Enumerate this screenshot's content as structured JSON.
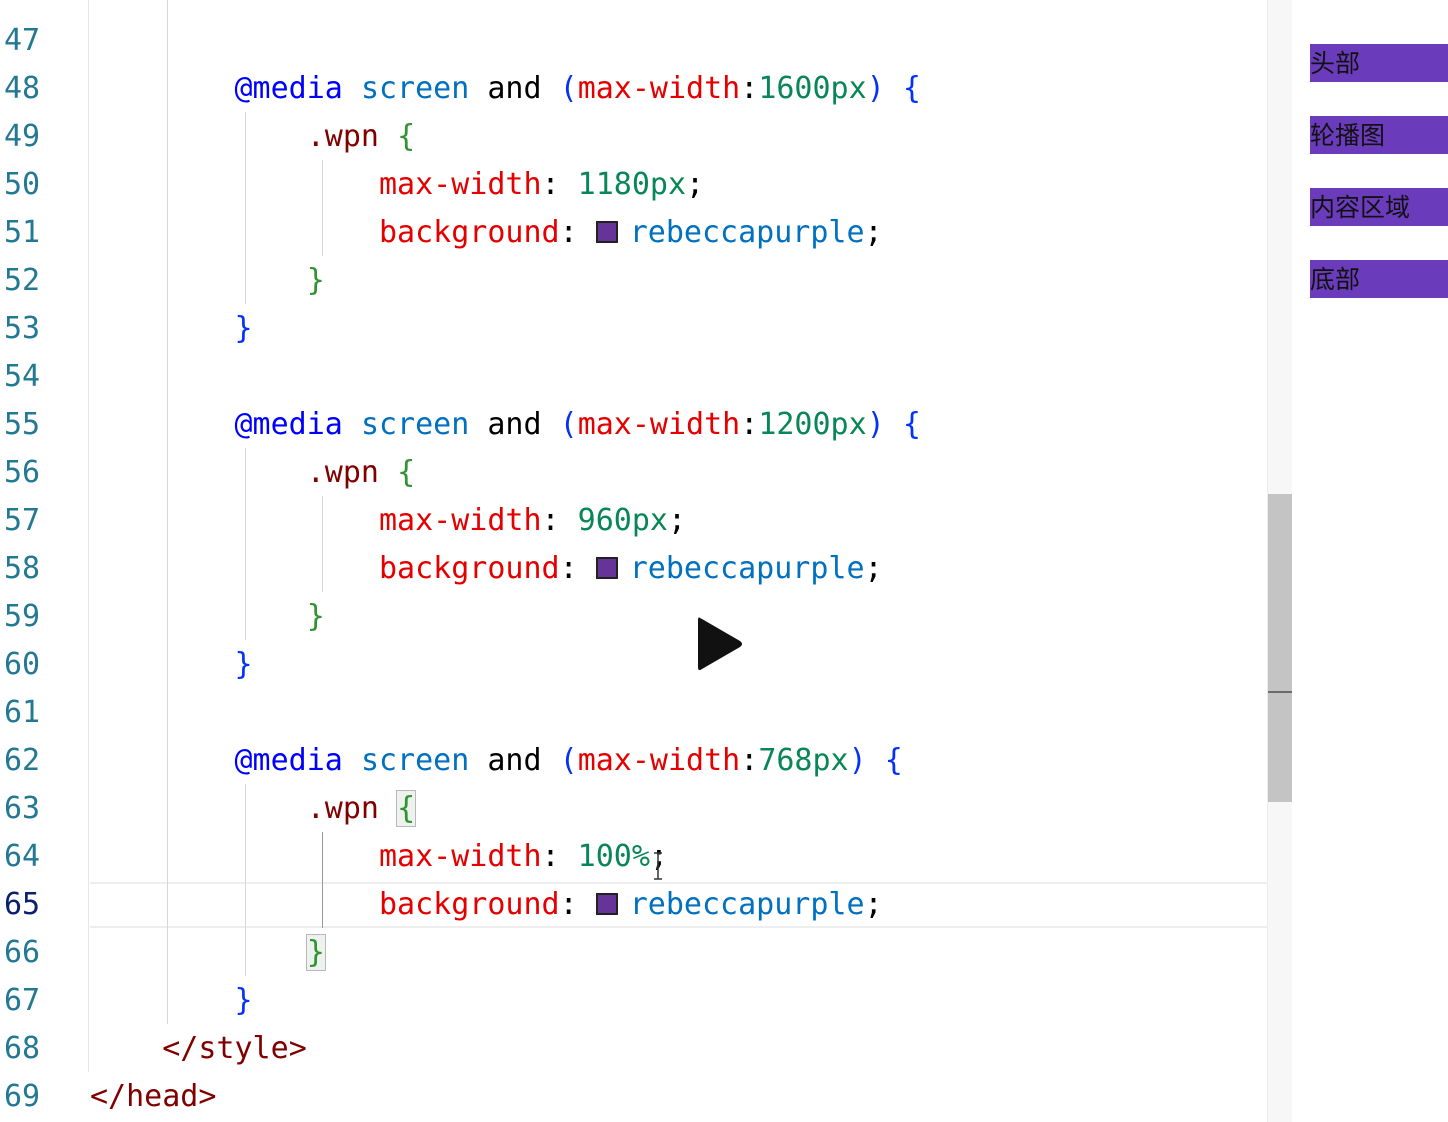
{
  "editor": {
    "lines": [
      {
        "num": "47",
        "tokens": []
      },
      {
        "num": "48",
        "tokens": [
          {
            "t": "        ",
            "c": ""
          },
          {
            "t": "@media",
            "c": "t-at"
          },
          {
            "t": " ",
            "c": ""
          },
          {
            "t": "screen",
            "c": "t-kw"
          },
          {
            "t": " and ",
            "c": ""
          },
          {
            "t": "(",
            "c": "t-paren"
          },
          {
            "t": "max-width",
            "c": "t-prop"
          },
          {
            "t": ":",
            "c": ""
          },
          {
            "t": "1600px",
            "c": "t-num"
          },
          {
            "t": ")",
            "c": "t-paren"
          },
          {
            "t": " ",
            "c": ""
          },
          {
            "t": "{",
            "c": "t-paren"
          }
        ]
      },
      {
        "num": "49",
        "tokens": [
          {
            "t": "            ",
            "c": ""
          },
          {
            "t": ".wpn",
            "c": "t-cls"
          },
          {
            "t": " ",
            "c": ""
          },
          {
            "t": "{",
            "c": "t-brace"
          }
        ]
      },
      {
        "num": "50",
        "tokens": [
          {
            "t": "                ",
            "c": ""
          },
          {
            "t": "max-width",
            "c": "t-prop"
          },
          {
            "t": ": ",
            "c": ""
          },
          {
            "t": "1180px",
            "c": "t-num"
          },
          {
            "t": ";",
            "c": ""
          }
        ]
      },
      {
        "num": "51",
        "tokens": [
          {
            "t": "                ",
            "c": ""
          },
          {
            "t": "background",
            "c": "t-prop"
          },
          {
            "t": ": ",
            "c": ""
          },
          {
            "t": "",
            "c": "swatch"
          },
          {
            "t": "rebeccapurple",
            "c": "t-kw"
          },
          {
            "t": ";",
            "c": ""
          }
        ]
      },
      {
        "num": "52",
        "tokens": [
          {
            "t": "            ",
            "c": ""
          },
          {
            "t": "}",
            "c": "t-brace"
          }
        ]
      },
      {
        "num": "53",
        "tokens": [
          {
            "t": "        ",
            "c": ""
          },
          {
            "t": "}",
            "c": "t-paren"
          }
        ]
      },
      {
        "num": "54",
        "tokens": []
      },
      {
        "num": "55",
        "tokens": [
          {
            "t": "        ",
            "c": ""
          },
          {
            "t": "@media",
            "c": "t-at"
          },
          {
            "t": " ",
            "c": ""
          },
          {
            "t": "screen",
            "c": "t-kw"
          },
          {
            "t": " and ",
            "c": ""
          },
          {
            "t": "(",
            "c": "t-paren"
          },
          {
            "t": "max-width",
            "c": "t-prop"
          },
          {
            "t": ":",
            "c": ""
          },
          {
            "t": "1200px",
            "c": "t-num"
          },
          {
            "t": ")",
            "c": "t-paren"
          },
          {
            "t": " ",
            "c": ""
          },
          {
            "t": "{",
            "c": "t-paren"
          }
        ]
      },
      {
        "num": "56",
        "tokens": [
          {
            "t": "            ",
            "c": ""
          },
          {
            "t": ".wpn",
            "c": "t-cls"
          },
          {
            "t": " ",
            "c": ""
          },
          {
            "t": "{",
            "c": "t-brace"
          }
        ]
      },
      {
        "num": "57",
        "tokens": [
          {
            "t": "                ",
            "c": ""
          },
          {
            "t": "max-width",
            "c": "t-prop"
          },
          {
            "t": ": ",
            "c": ""
          },
          {
            "t": "960px",
            "c": "t-num"
          },
          {
            "t": ";",
            "c": ""
          }
        ]
      },
      {
        "num": "58",
        "tokens": [
          {
            "t": "                ",
            "c": ""
          },
          {
            "t": "background",
            "c": "t-prop"
          },
          {
            "t": ": ",
            "c": ""
          },
          {
            "t": "",
            "c": "swatch"
          },
          {
            "t": "rebeccapurple",
            "c": "t-kw"
          },
          {
            "t": ";",
            "c": ""
          }
        ]
      },
      {
        "num": "59",
        "tokens": [
          {
            "t": "            ",
            "c": ""
          },
          {
            "t": "}",
            "c": "t-brace"
          }
        ]
      },
      {
        "num": "60",
        "tokens": [
          {
            "t": "        ",
            "c": ""
          },
          {
            "t": "}",
            "c": "t-paren"
          }
        ]
      },
      {
        "num": "61",
        "tokens": []
      },
      {
        "num": "62",
        "tokens": [
          {
            "t": "        ",
            "c": ""
          },
          {
            "t": "@media",
            "c": "t-at"
          },
          {
            "t": " ",
            "c": ""
          },
          {
            "t": "screen",
            "c": "t-kw"
          },
          {
            "t": " and ",
            "c": ""
          },
          {
            "t": "(",
            "c": "t-paren"
          },
          {
            "t": "max-width",
            "c": "t-prop"
          },
          {
            "t": ":",
            "c": ""
          },
          {
            "t": "768px",
            "c": "t-num"
          },
          {
            "t": ")",
            "c": "t-paren"
          },
          {
            "t": " ",
            "c": ""
          },
          {
            "t": "{",
            "c": "t-paren"
          }
        ]
      },
      {
        "num": "63",
        "tokens": [
          {
            "t": "            ",
            "c": ""
          },
          {
            "t": ".wpn",
            "c": "t-cls"
          },
          {
            "t": " ",
            "c": ""
          },
          {
            "t": "{",
            "c": "t-brace brace-hl"
          }
        ]
      },
      {
        "num": "64",
        "tokens": [
          {
            "t": "                ",
            "c": ""
          },
          {
            "t": "max-width",
            "c": "t-prop"
          },
          {
            "t": ": ",
            "c": ""
          },
          {
            "t": "100%",
            "c": "t-num"
          },
          {
            "t": ";",
            "c": ""
          }
        ]
      },
      {
        "num": "65",
        "tokens": [
          {
            "t": "                ",
            "c": ""
          },
          {
            "t": "background",
            "c": "t-prop"
          },
          {
            "t": ": ",
            "c": ""
          },
          {
            "t": "",
            "c": "swatch"
          },
          {
            "t": "rebeccapurple",
            "c": "t-kw"
          },
          {
            "t": ";",
            "c": ""
          }
        ]
      },
      {
        "num": "66",
        "tokens": [
          {
            "t": "            ",
            "c": ""
          },
          {
            "t": "}",
            "c": "t-brace brace-hl"
          }
        ]
      },
      {
        "num": "67",
        "tokens": [
          {
            "t": "        ",
            "c": ""
          },
          {
            "t": "}",
            "c": "t-paren"
          }
        ]
      },
      {
        "num": "68",
        "tokens": [
          {
            "t": "    ",
            "c": ""
          },
          {
            "t": "</",
            "c": "t-punc"
          },
          {
            "t": "style",
            "c": "t-tag"
          },
          {
            "t": ">",
            "c": "t-punc"
          }
        ]
      },
      {
        "num": "69",
        "tokens": [
          {
            "t": "</",
            "c": "t-punc"
          },
          {
            "t": "head",
            "c": "t-tag"
          },
          {
            "t": ">",
            "c": "t-punc"
          }
        ]
      }
    ],
    "active_line": "65",
    "swatch_color": "#663399"
  },
  "preview": {
    "items": [
      {
        "label": "头部"
      },
      {
        "label": "轮播图"
      },
      {
        "label": "内容区域"
      },
      {
        "label": "底部"
      }
    ],
    "bar_color": "#6a3cbc"
  },
  "video": {
    "play_icon": "play-icon"
  }
}
